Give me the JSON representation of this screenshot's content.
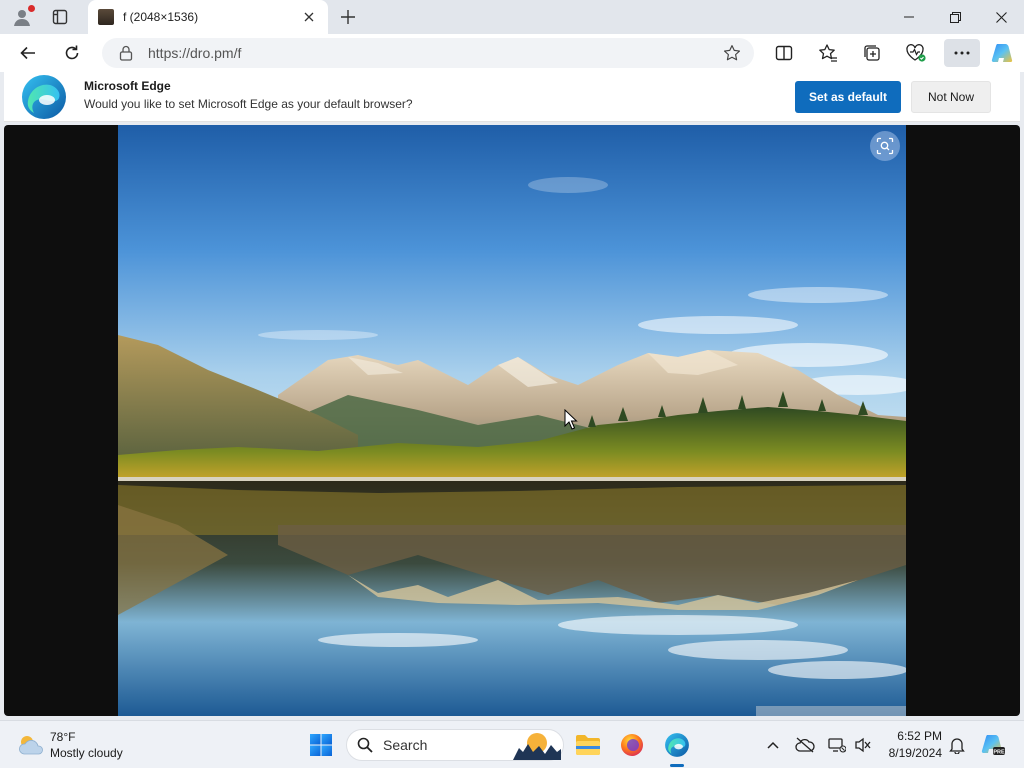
{
  "tab": {
    "title": "f (2048×1536)"
  },
  "address": {
    "url": "https://dro.pm/f"
  },
  "infobar": {
    "title": "Microsoft Edge",
    "message": "Would you like to set Microsoft Edge as your default browser?",
    "primary_label": "Set as default",
    "secondary_label": "Not Now"
  },
  "taskbar": {
    "weather_temp": "78°F",
    "weather_desc": "Mostly cloudy",
    "search_label": "Search",
    "time": "6:52 PM",
    "date": "8/19/2024"
  },
  "colors": {
    "accent": "#0f6cbd",
    "titlebar": "#e2e6ec",
    "taskbar": "#eef1f6"
  }
}
